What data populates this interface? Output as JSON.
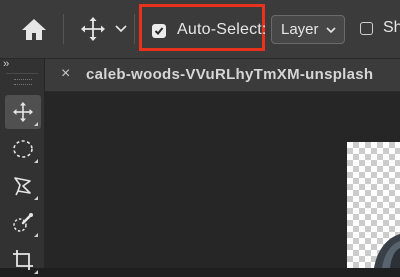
{
  "options_bar": {
    "auto_select_label": "Auto-Select:",
    "auto_select_checked": true,
    "layer_dropdown_value": "Layer",
    "show_label_partial": "Sh"
  },
  "toolbar": {
    "collapse_glyph": "››",
    "tools": [
      "move-tool",
      "elliptical-marquee-tool",
      "lasso-tool",
      "quick-selection-tool",
      "crop-tool"
    ],
    "active_tool": "move-tool"
  },
  "document_tab": {
    "close_glyph": "×",
    "title": "caleb-woods-VVuRLhyTmXM-unsplash"
  },
  "colors": {
    "highlight_outline": "#e8321e",
    "panel_bg": "#3b3b3b",
    "canvas_bg": "#262626"
  }
}
